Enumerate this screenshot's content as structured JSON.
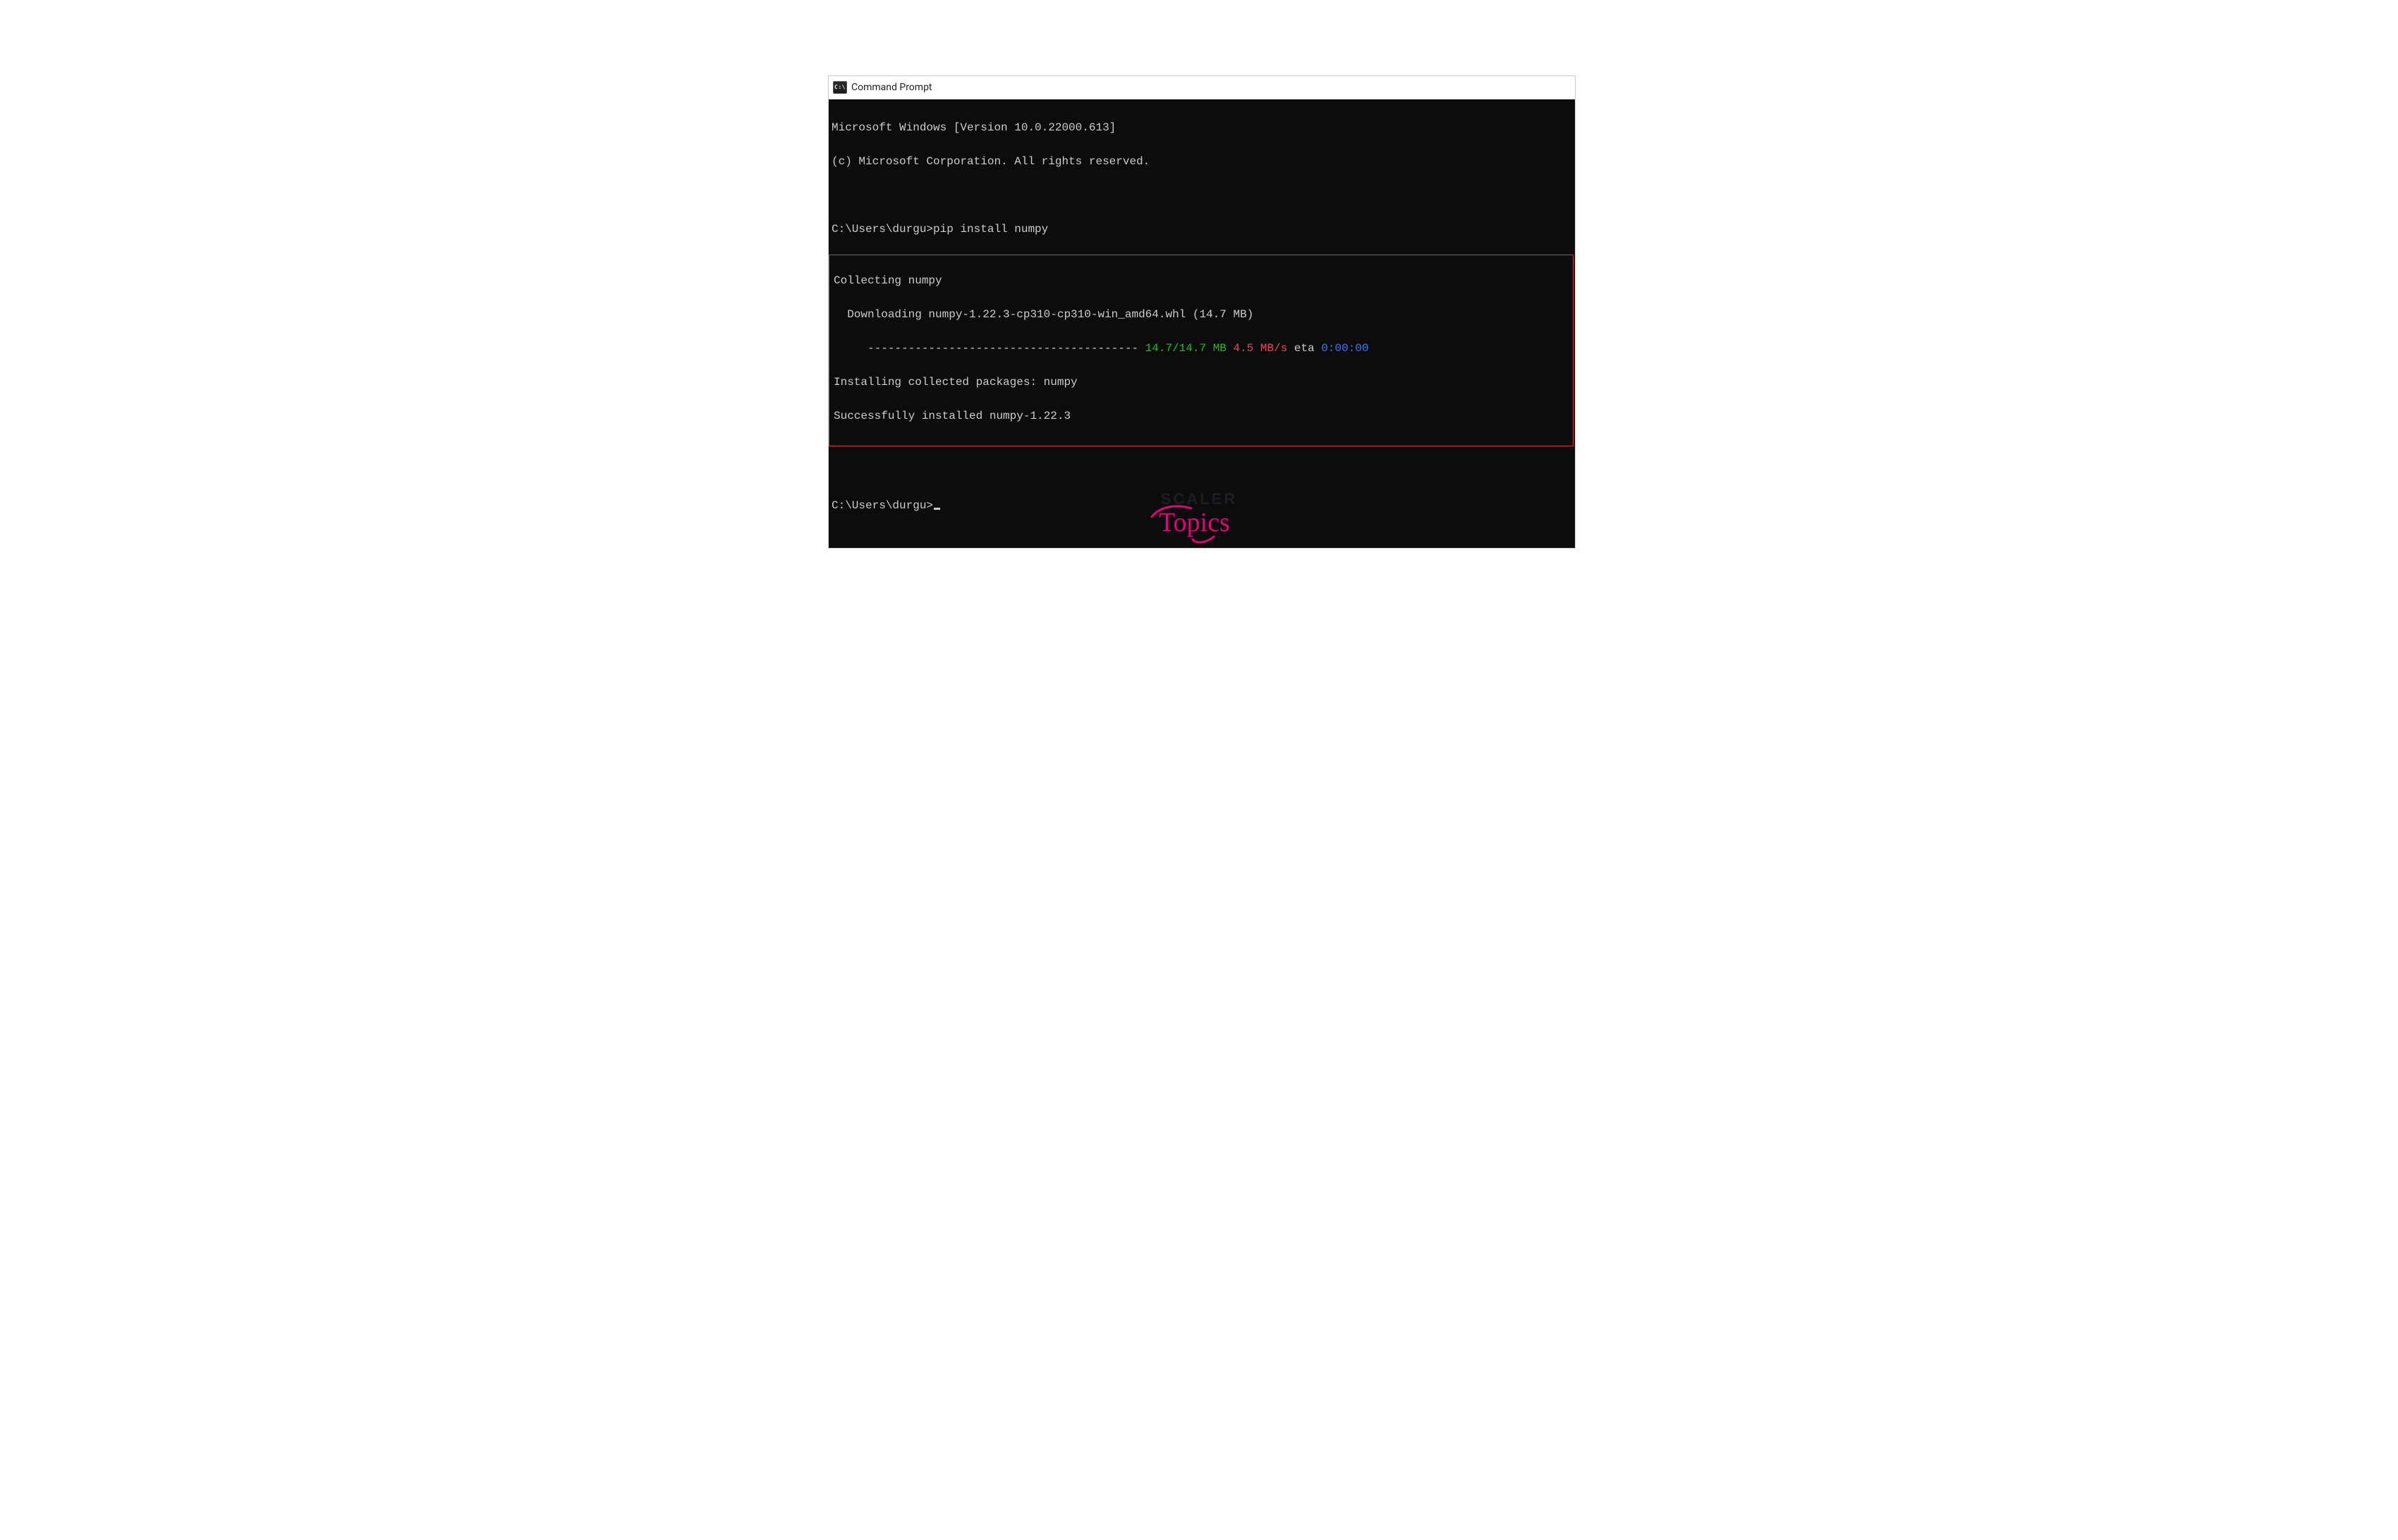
{
  "window": {
    "icon_text": "C:\\",
    "title": "Command Prompt"
  },
  "console": {
    "banner_version": "Microsoft Windows [Version 10.0.22000.613]",
    "banner_copyright": "(c) Microsoft Corporation. All rights reserved.",
    "prompt1_path": "C:\\Users\\durgu>",
    "prompt1_cmd": "pip install numpy",
    "collecting": "Collecting numpy",
    "downloading": "  Downloading numpy-1.22.3-cp310-cp310-win_amd64.whl (14.7 MB)",
    "progress_bar": "     ---------------------------------------- ",
    "progress_green": "14.7/14.7 MB",
    "progress_red": " 4.5 MB/s",
    "progress_eta_label": " eta ",
    "progress_eta": "0:00:00",
    "installing": "Installing collected packages: numpy",
    "success": "Successfully installed numpy-1.22.3",
    "prompt2_path": "C:\\Users\\durgu>"
  },
  "branding": {
    "line1": "SCALER",
    "line2": "Topics"
  },
  "colors": {
    "console_bg": "#0c0c0c",
    "console_fg": "#cccccc",
    "green": "#16c60c",
    "red": "#e74856",
    "blue": "#3b78ff",
    "highlight_border": "#d23a3a",
    "brand_pink": "#e6007e"
  }
}
